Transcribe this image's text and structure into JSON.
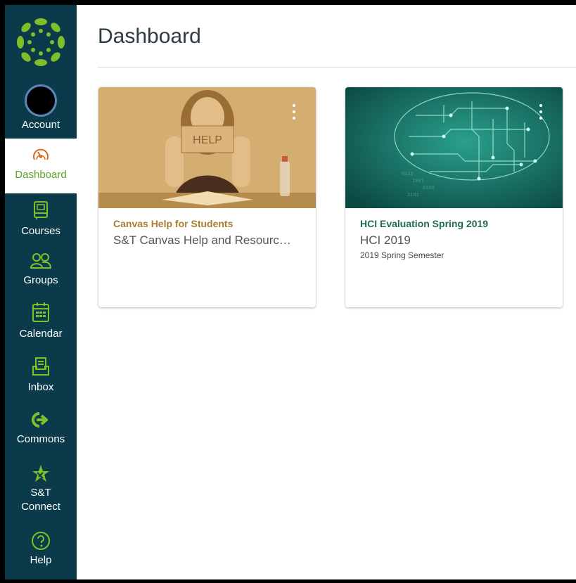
{
  "sidebar": {
    "logo_icon": "canvas-logo-icon",
    "accent": "#7fbf2a",
    "bg": "#0b3a4a",
    "items": [
      {
        "key": "account",
        "label": "Account",
        "icon": "avatar"
      },
      {
        "key": "dashboard",
        "label": "Dashboard",
        "icon": "dashboard-icon",
        "active": true
      },
      {
        "key": "courses",
        "label": "Courses",
        "icon": "courses-icon"
      },
      {
        "key": "groups",
        "label": "Groups",
        "icon": "groups-icon"
      },
      {
        "key": "calendar",
        "label": "Calendar",
        "icon": "calendar-icon"
      },
      {
        "key": "inbox",
        "label": "Inbox",
        "icon": "inbox-icon"
      },
      {
        "key": "commons",
        "label": "Commons",
        "icon": "commons-icon"
      },
      {
        "key": "connect",
        "label_line1": "S&T",
        "label_line2": "Connect",
        "icon": "star-icon"
      },
      {
        "key": "help",
        "label": "Help",
        "icon": "help-icon"
      }
    ]
  },
  "main": {
    "title": "Dashboard",
    "cards": [
      {
        "name": "Canvas Help for Students",
        "code": "S&T Canvas Help and Resourc…",
        "term": "",
        "color": "#a87d2e",
        "hero_text": "HELP"
      },
      {
        "name": "HCI Evaluation Spring 2019",
        "code": "HCI 2019",
        "term": "2019 Spring Semester",
        "color": "#1d6a5a"
      }
    ]
  }
}
